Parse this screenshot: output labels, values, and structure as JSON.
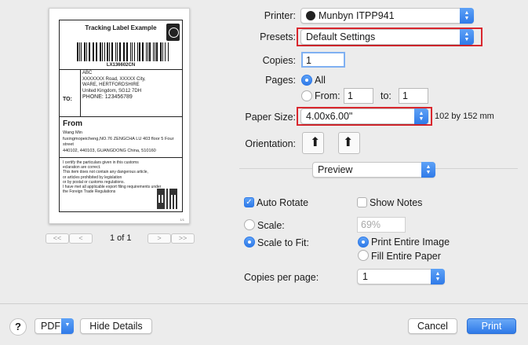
{
  "preview": {
    "label_title": "Tracking Label Example",
    "tracking_number": "LX136602CN",
    "to_label": "TO:",
    "to_address": [
      "ABC",
      "XXXXXXX Road, XXXXX City,",
      "WARE, HERTFORDSHIRE",
      "United Kingdom, SG12 7DH",
      "PHONE: 123456789"
    ],
    "from_label": "From",
    "from_address": [
      "Wang Min",
      "fuxingmopeicheng,NO.76 ZENGCHA LU 403 floor 5 Four street",
      "440102, 440103, GUANGDONG  China, 510160"
    ],
    "certification": [
      "I certify the particulars given in this customs",
      "eclaration are correct.",
      "This item does not contain any dangerous article,",
      "or articles prohibited by legislation",
      "or by postal or customs regulations.",
      "I have met all applicable export filing requirements under",
      "the Foreign Trade Regulations"
    ],
    "page_mark": "1/1"
  },
  "pager": {
    "first": "<<",
    "prev": "<",
    "next": ">",
    "last": ">>",
    "page_text": "1 of 1"
  },
  "form": {
    "printer_label": "Printer:",
    "printer_value": "Munbyn ITPP941",
    "presets_label": "Presets:",
    "presets_value": "Default Settings",
    "copies_label": "Copies:",
    "copies_value": "1",
    "pages_label": "Pages:",
    "pages_all": "All",
    "pages_from": "From:",
    "from_value": "1",
    "pages_to": "to:",
    "to_value": "1",
    "paper_size_label": "Paper Size:",
    "paper_size_value": "4.00x6.00\"",
    "paper_size_dims": "102 by 152 mm",
    "orientation_label": "Orientation:",
    "section_value": "Preview",
    "auto_rotate": "Auto Rotate",
    "show_notes": "Show Notes",
    "scale_label": "Scale:",
    "scale_value": "69%",
    "scale_to_fit_label": "Scale to Fit:",
    "print_entire_image": "Print Entire Image",
    "fill_entire_paper": "Fill Entire Paper",
    "copies_per_page_label": "Copies per page:",
    "copies_per_page_value": "1"
  },
  "bottom": {
    "help": "?",
    "pdf": "PDF",
    "hide_details": "Hide Details",
    "cancel": "Cancel",
    "print": "Print"
  },
  "colors": {
    "accent": "#2f7ae8",
    "highlight": "#d9272e",
    "window_bg": "#ececec"
  }
}
